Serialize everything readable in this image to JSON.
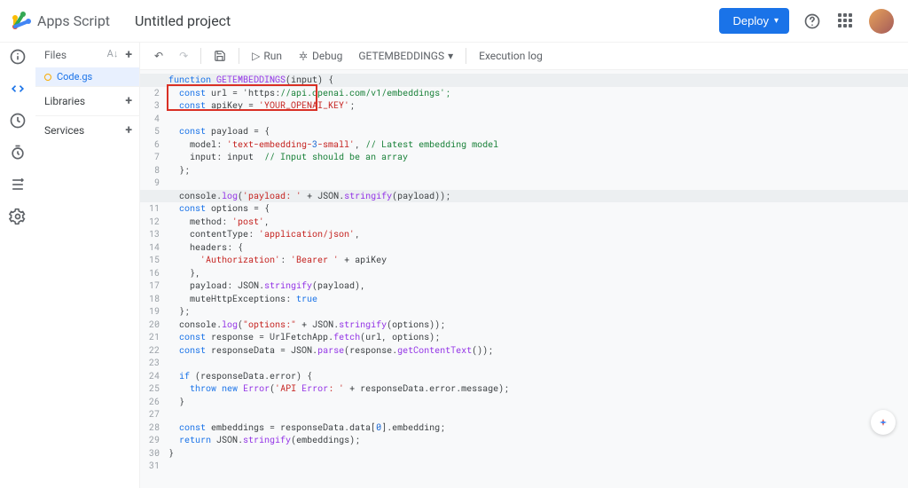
{
  "header": {
    "product_name": "Apps Script",
    "project_title": "Untitled project",
    "deploy_label": "Deploy"
  },
  "sidebar": {
    "files_label": "Files",
    "libraries_label": "Libraries",
    "services_label": "Services",
    "file_name": "Code.gs"
  },
  "toolbar": {
    "run_label": "Run",
    "debug_label": "Debug",
    "function_name": "GETEMBEDDINGS",
    "exec_log_label": "Execution log"
  },
  "code_lines": [
    "function GETEMBEDDINGS(input) {",
    "  const url = 'https://api.openai.com/v1/embeddings';",
    "  const apiKey = 'YOUR_OPENAI_KEY';",
    "",
    "  const payload = {",
    "    model: 'text-embedding-3-small', // Latest embedding model",
    "    input: input  // Input should be an array",
    "  };",
    "",
    "  console.log('payload: ' + JSON.stringify(payload));",
    "  const options = {",
    "    method: 'post',",
    "    contentType: 'application/json',",
    "    headers: {",
    "      'Authorization': 'Bearer ' + apiKey",
    "    },",
    "    payload: JSON.stringify(payload),",
    "    muteHttpExceptions: true",
    "  };",
    "  console.log(\"options:\" + JSON.stringify(options));",
    "  const response = UrlFetchApp.fetch(url, options);",
    "  const responseData = JSON.parse(response.getContentText());",
    "",
    "  if (responseData.error) {",
    "    throw new Error('API Error: ' + responseData.error.message);",
    "  }",
    "",
    "  const embeddings = responseData.data[0].embedding;",
    "  return JSON.stringify(embeddings);",
    "}",
    ""
  ]
}
